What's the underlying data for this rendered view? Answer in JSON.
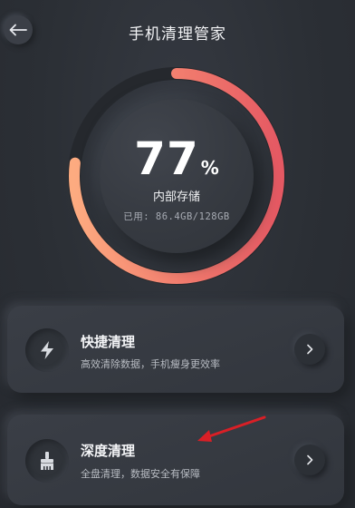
{
  "header": {
    "title": "手机清理管家",
    "back_icon": "arrow-left-icon"
  },
  "storage": {
    "percent": "77",
    "percent_sign": "%",
    "usage_fraction": 0.77,
    "label": "内部存储",
    "used_text": "已用: 86.4GB/128GB",
    "ring_gradient": [
      "#fda97f",
      "#f06a6a",
      "#e55a64"
    ],
    "ring_track": "#25282d"
  },
  "cards": [
    {
      "title": "快捷清理",
      "subtitle": "高效清除数据，手机瘦身更效率",
      "icon": "lightning-bolt-icon",
      "action_icon": "chevron-right-icon"
    },
    {
      "title": "深度清理",
      "subtitle": "全盘清理，数据安全有保障",
      "icon": "broom-icon",
      "action_icon": "chevron-right-icon"
    }
  ],
  "colors": {
    "background": "#2d3138",
    "card": "#363a41",
    "accent_arrow": "#d91f26"
  }
}
